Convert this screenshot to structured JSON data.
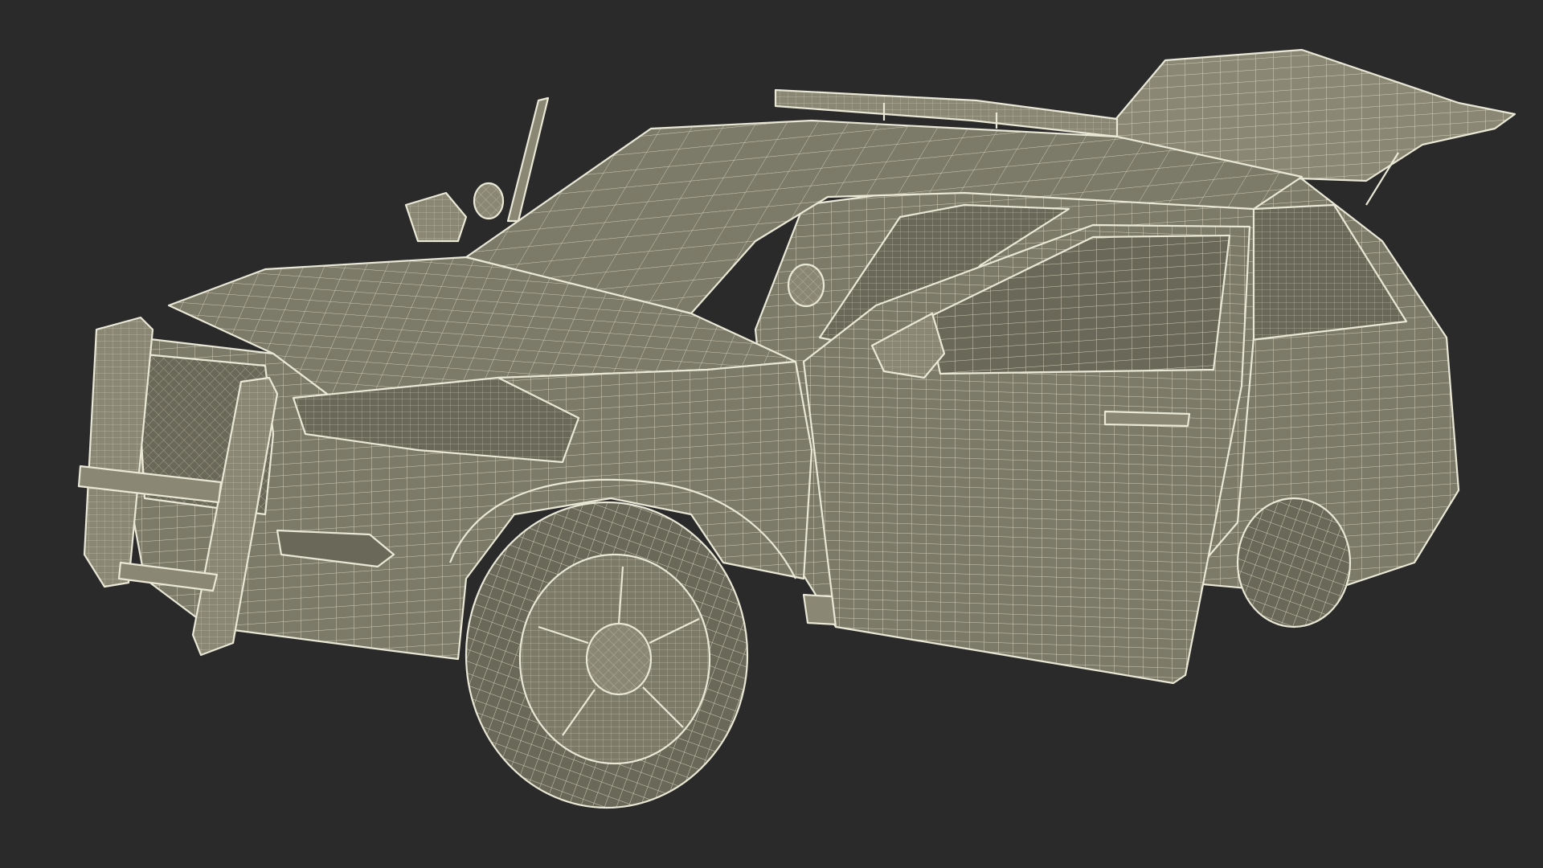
{
  "scene": {
    "background_color": "#2b2b2b",
    "model_fill_color": "#7c7a68",
    "wire_color": "#e9e7d6",
    "subject": "police-suv-wireframe-render",
    "state": {
      "front_door": "open",
      "tailgate": "open"
    }
  }
}
